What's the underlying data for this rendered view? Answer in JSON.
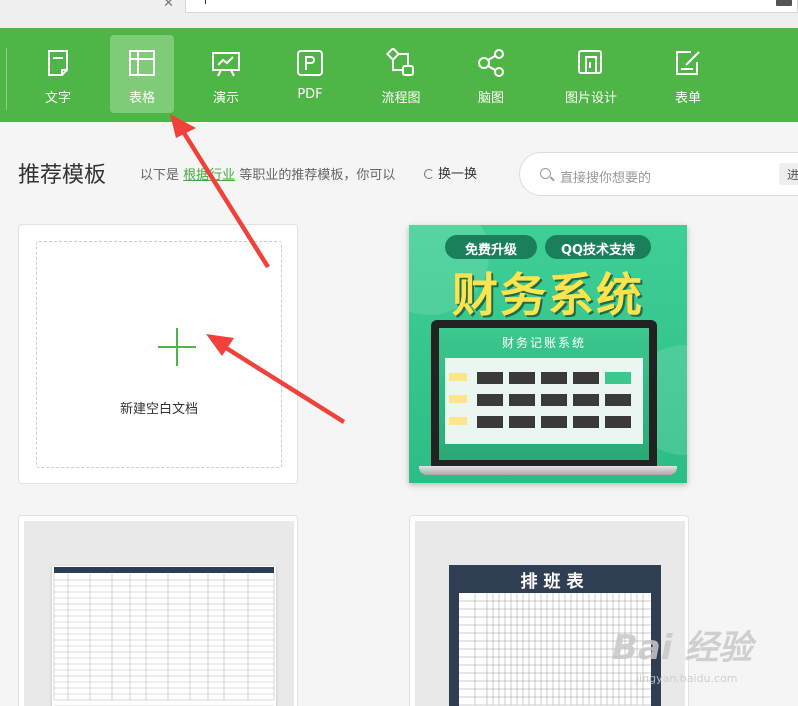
{
  "colors": {
    "brand_green": "#4fb546",
    "active_tab": "#7fcb78",
    "arrow_red": "#f0413a"
  },
  "toolbar": {
    "items": [
      {
        "label": "文字",
        "icon": "doc-icon"
      },
      {
        "label": "表格",
        "icon": "table-icon",
        "active": true
      },
      {
        "label": "演示",
        "icon": "presentation-icon"
      },
      {
        "label": "PDF",
        "icon": "pdf-icon"
      },
      {
        "label": "流程图",
        "icon": "flowchart-icon"
      },
      {
        "label": "脑图",
        "icon": "mindmap-icon"
      },
      {
        "label": "图片设计",
        "icon": "image-design-icon"
      },
      {
        "label": "表单",
        "icon": "form-icon"
      }
    ]
  },
  "heading": {
    "title": "推荐模板",
    "desc_prefix": "以下是",
    "desc_link": "根据行业",
    "desc_suffix": "等职业的推荐模板，你可以",
    "refresh_label": "换一换"
  },
  "search": {
    "placeholder": "直接搜你想要的",
    "button": "进"
  },
  "new_doc": {
    "label": "新建空白文档"
  },
  "templates": {
    "finance": {
      "pill_left": "免费升级",
      "pill_right": "QQ技术支持",
      "big_title": "财务系统",
      "screen_title": "财务记账系统"
    },
    "schedule": {
      "title": "排班表"
    }
  },
  "watermark": {
    "line1": "Bai 经验",
    "line2": "jingyan.baidu.com"
  }
}
